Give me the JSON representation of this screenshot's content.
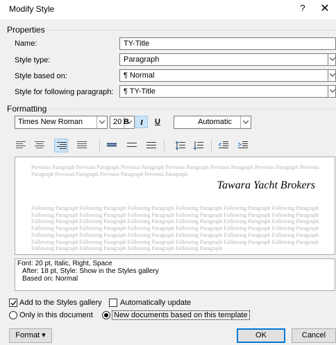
{
  "window": {
    "title": "Modify Style",
    "help_label": "?",
    "close_label": "✕"
  },
  "properties": {
    "section_label": "Properties",
    "name": {
      "label": "Name:",
      "value": "TY-Title"
    },
    "style_type": {
      "label": "Style type:",
      "value": "Paragraph"
    },
    "style_based_on": {
      "label": "Style based on:",
      "value": "¶  Normal"
    },
    "style_following": {
      "label": "Style for following paragraph:",
      "value": "¶  TY-Title"
    }
  },
  "formatting": {
    "section_label": "Formatting",
    "font": "Times New Roman",
    "size": "20",
    "bold_label": "B",
    "italic_label": "I",
    "underline_label": "U",
    "color": "Automatic"
  },
  "preview": {
    "previous_paragraph": "Previous Paragraph Previous Paragraph Previous Paragraph Previous Paragraph Previous Paragraph Previous Paragraph Previous Paragraph Previous Paragraph Previous Paragraph Previous Paragraph",
    "sample_text": "Tawara Yacht Brokers",
    "following_paragraph": "Following Paragraph Following Paragraph Following Paragraph Following Paragraph Following Paragraph Following Paragraph Following Paragraph Following Paragraph Following Paragraph Following Paragraph Following Paragraph Following Paragraph Following Paragraph Following Paragraph Following Paragraph Following Paragraph Following Paragraph Following Paragraph Following Paragraph Following Paragraph Following Paragraph Following Paragraph Following Paragraph Following Paragraph Following Paragraph Following Paragraph Following Paragraph Following Paragraph Following Paragraph Following Paragraph Following Paragraph Following Paragraph Following Paragraph Following Paragraph Following Paragraph Following Paragraph Following Paragraph Following Paragraph Following Paragraph Following Paragraph"
  },
  "description": {
    "line1": "Font: 20 pt, Italic, Right, Space",
    "line2": "After:  18 pt, Style: Show in the Styles gallery",
    "line3": "Based on: Normal"
  },
  "options": {
    "add_to_gallery": "Add to the Styles gallery",
    "add_to_gallery_checked": true,
    "auto_update": "Automatically update",
    "auto_update_checked": false,
    "only_this_document": "Only in this document",
    "new_documents": "New documents based on this template",
    "selected_scope": "new_documents"
  },
  "buttons": {
    "format": "Format ▾",
    "ok": "OK",
    "cancel": "Cancel"
  },
  "colors": {
    "accent": "#0078d7",
    "selected_bg": "#cce4f7",
    "dialog_bg": "#f0f0f0"
  }
}
